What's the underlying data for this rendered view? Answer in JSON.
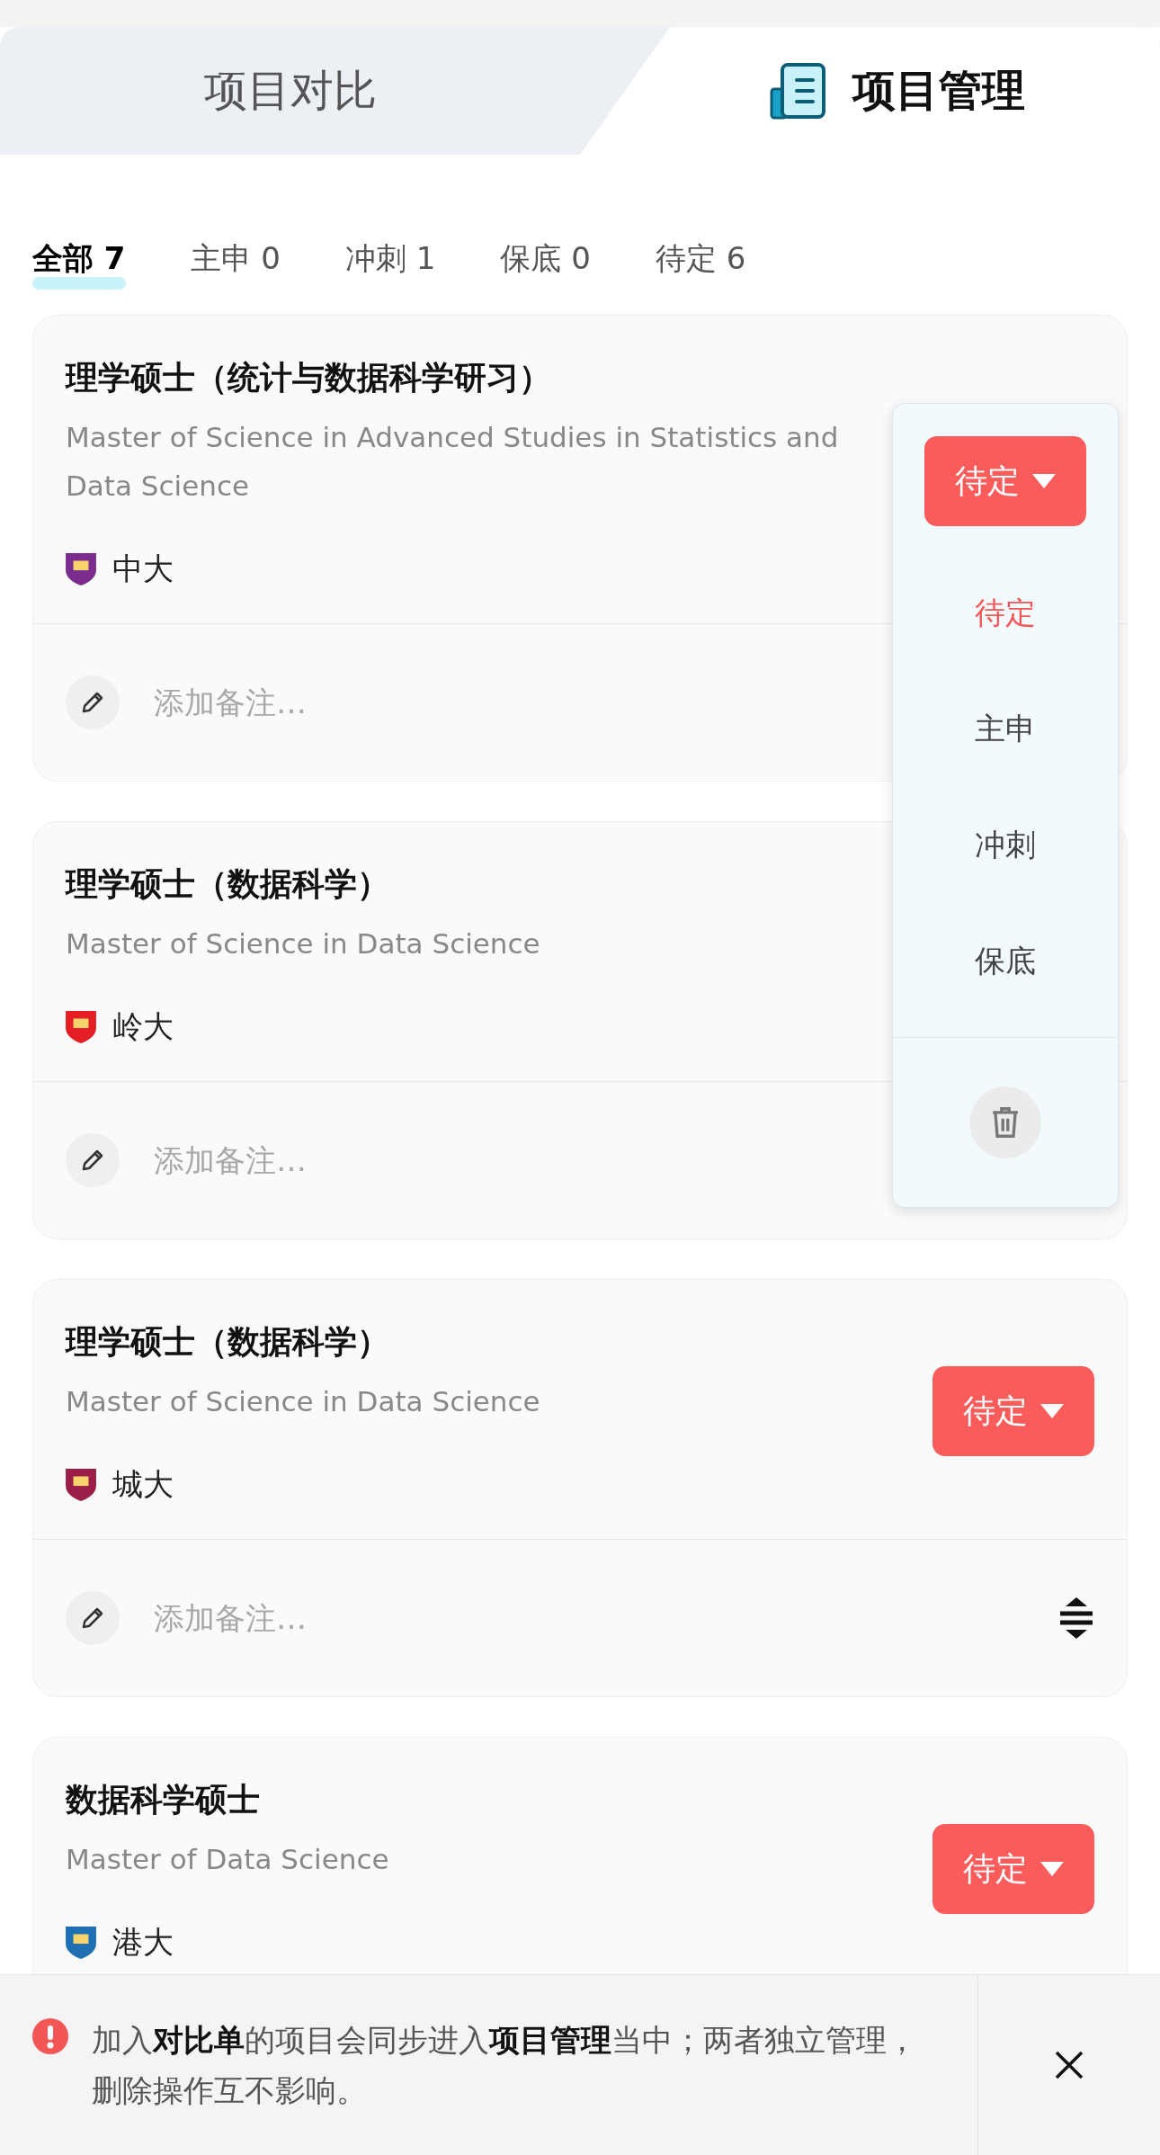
{
  "top_tabs": [
    {
      "label": "项目对比",
      "selected": false
    },
    {
      "label": "项目管理",
      "selected": true
    }
  ],
  "filters": [
    {
      "label": "全部 7",
      "selected": true
    },
    {
      "label": "主申 0",
      "selected": false
    },
    {
      "label": "冲刺 1",
      "selected": false
    },
    {
      "label": "保底 0",
      "selected": false
    },
    {
      "label": "待定 6",
      "selected": false
    }
  ],
  "cards": [
    {
      "title": "理学硕士（统计与数据科学研习）",
      "subtitle": "Master of Science in Advanced Studies in Statistics and Data Science",
      "school": "中大",
      "color": "#7b2d8e",
      "note_placeholder": "添加备注…"
    },
    {
      "title": "理学硕士（数据科学）",
      "subtitle": "Master of Science in Data Science",
      "school": "岭大",
      "color": "#e31e24",
      "note_placeholder": "添加备注…"
    },
    {
      "title": "理学硕士（数据科学）",
      "subtitle": "Master of Science in Data Science",
      "school": "城大",
      "color": "#9b1d4a",
      "status": "待定",
      "note_placeholder": "添加备注…",
      "sort_handle": true
    },
    {
      "title": "数据科学硕士",
      "subtitle": "Master of Data Science",
      "school": "港大",
      "color": "#1f6fb5",
      "status": "待定"
    }
  ],
  "dropdown": {
    "status": "待定",
    "options": [
      {
        "label": "待定",
        "selected": true
      },
      {
        "label": "主申",
        "selected": false
      },
      {
        "label": "冲刺",
        "selected": false
      },
      {
        "label": "保底",
        "selected": false
      }
    ]
  },
  "banner": {
    "text": "加入**对比单**的项目会同步进入**项目管理**当中；两者独立管理，删除操作互不影响。"
  }
}
